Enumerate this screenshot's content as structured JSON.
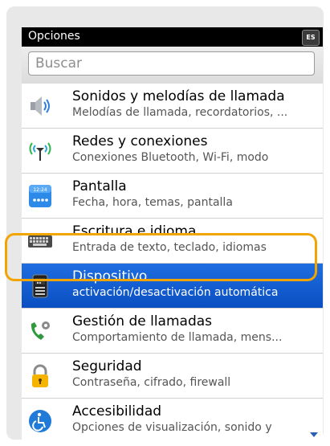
{
  "header": {
    "title": "Opciones",
    "lang_badge": "ES"
  },
  "search": {
    "placeholder": "Buscar"
  },
  "items": [
    {
      "label": "Sonidos y melodías de llamada",
      "sub": "Melodías de llamada, recordatorios, ...",
      "icon": "speaker-icon"
    },
    {
      "label": "Redes y conexiones",
      "sub": "Conexiones Bluetooth, Wi-Fi, modo",
      "icon": "antenna-icon"
    },
    {
      "label": "Pantalla",
      "sub": "Fecha, hora, temas, pantalla",
      "icon": "calendar-icon",
      "icon_text": "12:24"
    },
    {
      "label": "Escritura e idioma",
      "sub": "Entrada de texto, teclado, idiomas",
      "icon": "keyboard-icon"
    },
    {
      "label": "Dispositivo",
      "sub": "activación/desactivación automática",
      "icon": "device-icon",
      "selected": true
    },
    {
      "label": "Gestión de llamadas",
      "sub": "Comportamiento de llamada, mens...",
      "icon": "phone-gear-icon"
    },
    {
      "label": "Seguridad",
      "sub": "Contraseña, cifrado, firewall",
      "icon": "lock-icon"
    },
    {
      "label": "Accesibilidad",
      "sub": "Opciones de visualización, sonido y",
      "icon": "accessibility-icon"
    }
  ],
  "colors": {
    "selection": "#0a4fc2",
    "highlight_ring": "#f2a400"
  }
}
